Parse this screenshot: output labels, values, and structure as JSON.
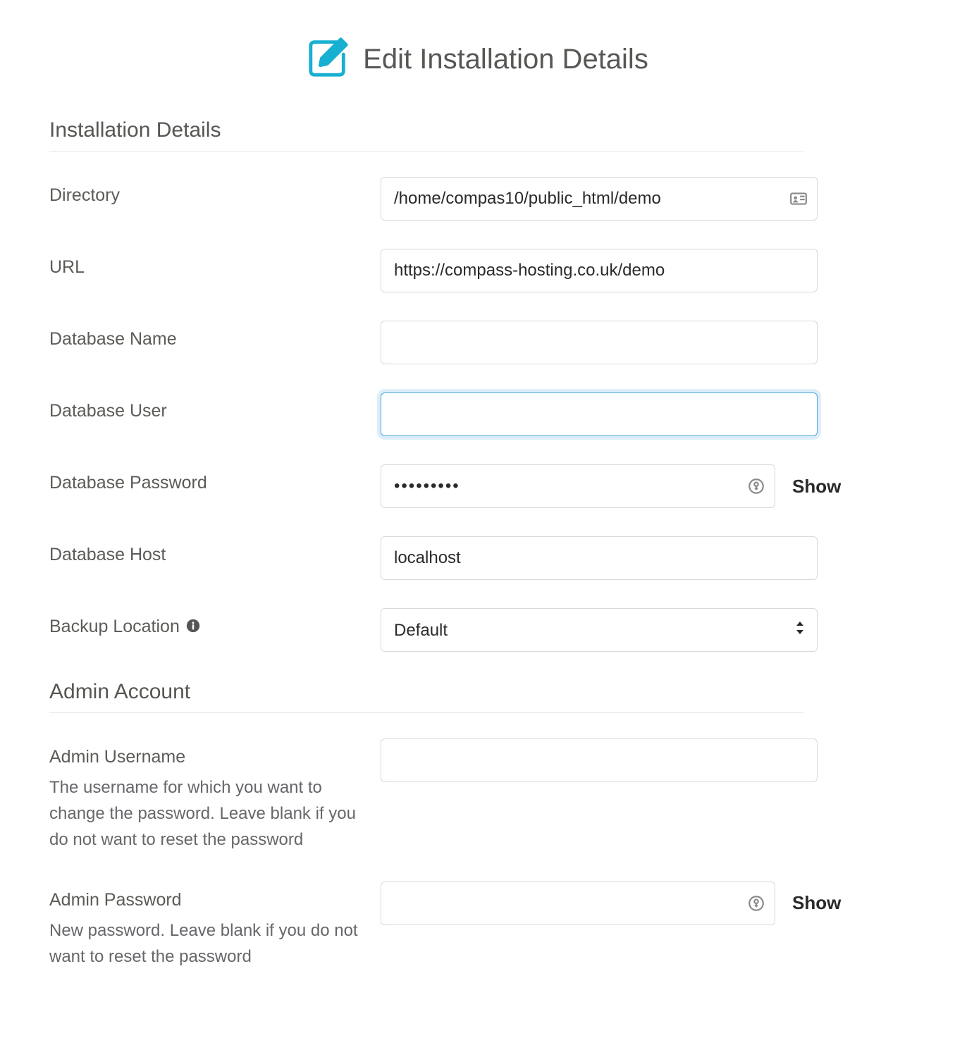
{
  "page": {
    "title": "Edit Installation Details"
  },
  "sections": {
    "install": {
      "heading": "Installation Details",
      "directory": {
        "label": "Directory",
        "value": "/home/compas10/public_html/demo"
      },
      "url": {
        "label": "URL",
        "value": "https://compass-hosting.co.uk/demo"
      },
      "db_name": {
        "label": "Database Name",
        "value": ""
      },
      "db_user": {
        "label": "Database User",
        "value": ""
      },
      "db_pass": {
        "label": "Database Password",
        "value": "•••••••••",
        "show": "Show"
      },
      "db_host": {
        "label": "Database Host",
        "value": "localhost"
      },
      "backup": {
        "label": "Backup Location",
        "value": "Default"
      }
    },
    "admin": {
      "heading": "Admin Account",
      "username": {
        "label": "Admin Username",
        "help": "The username for which you want to change the password. Leave blank if you do not want to reset the password",
        "value": ""
      },
      "password": {
        "label": "Admin Password",
        "help": "New password. Leave blank if you do not want to reset the password",
        "value": "",
        "show": "Show"
      }
    }
  }
}
